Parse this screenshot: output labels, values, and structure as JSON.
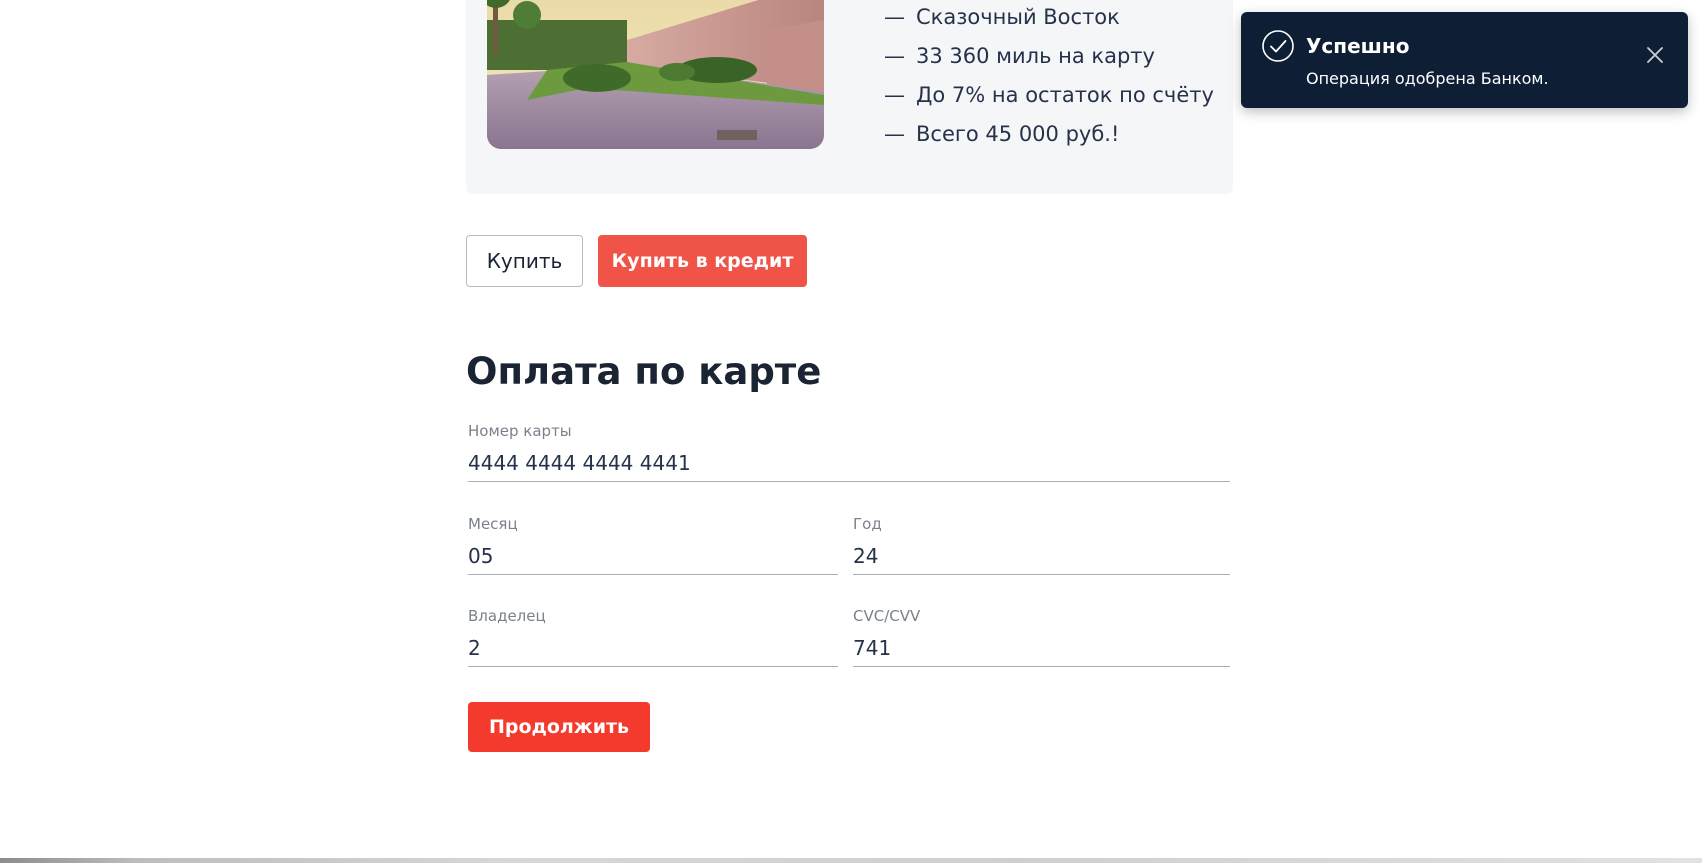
{
  "offer": {
    "features": [
      "Сказочный Восток",
      "33 360 миль на карту",
      "До 7% на остаток по счёту",
      "Всего 45 000 руб.!"
    ],
    "bullet": "—"
  },
  "actions": {
    "buy_label": "Купить",
    "credit_label": "Купить в кредит"
  },
  "payment": {
    "title": "Оплата по карте",
    "card_number": {
      "label": "Номер карты",
      "value": "4444 4444 4444 4441"
    },
    "month": {
      "label": "Месяц",
      "value": "05"
    },
    "year": {
      "label": "Год",
      "value": "24"
    },
    "owner": {
      "label": "Владелец",
      "value": "2"
    },
    "cvc": {
      "label": "CVC/CVV",
      "value": "741"
    },
    "continue_label": "Продолжить"
  },
  "notification": {
    "title": "Успешно",
    "message": "Операция одобрена Банком.",
    "icon": "check-circle-icon",
    "close_icon": "close-icon"
  },
  "colors": {
    "accent_red": "#f43a2c",
    "credit_red": "#f05448",
    "toast_bg": "#0e1f35",
    "card_bg": "#f5f6f8"
  }
}
